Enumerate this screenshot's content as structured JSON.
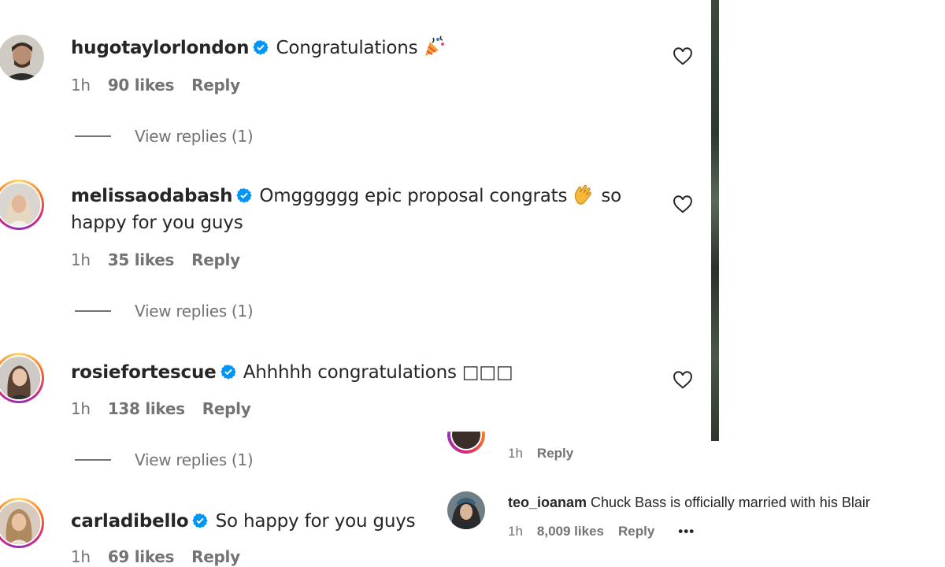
{
  "comments": [
    {
      "username": "hugotaylorlondon",
      "text": "Congratulations",
      "emoji": "party-popper",
      "time": "1h",
      "likes": "90 likes",
      "reply_label": "Reply",
      "view_replies": "View replies (1)"
    },
    {
      "username": "melissaodabash",
      "text": "Omgggggg epic proposal congrats",
      "emoji": "clapping-hands",
      "text_after": "so happy for you guys",
      "time": "1h",
      "likes": "35 likes",
      "reply_label": "Reply",
      "view_replies": "View replies (1)"
    },
    {
      "username": "rosiefortescue",
      "text": "Ahhhhh congratulations □□□",
      "time": "1h",
      "likes": "138 likes",
      "reply_label": "Reply",
      "view_replies": "View replies (1)"
    },
    {
      "username": "carladibello",
      "text": "So happy for you guys",
      "time": "1h",
      "likes": "69 likes",
      "reply_label": "Reply"
    }
  ],
  "overlay": {
    "top_meta": {
      "time": "1h",
      "reply_label": "Reply"
    },
    "comment": {
      "username": "teo_ioanam",
      "text": "Chuck Bass is officially married with his Blair",
      "time": "1h",
      "likes": "8,009 likes",
      "reply_label": "Reply",
      "more": "•••"
    }
  },
  "colors": {
    "text": "#262626",
    "secondary": "#737373",
    "verified": "#0095f6"
  },
  "icons": [
    "verified-badge-icon",
    "heart-icon",
    "party-popper-emoji",
    "clapping-hands-emoji",
    "more-icon"
  ]
}
